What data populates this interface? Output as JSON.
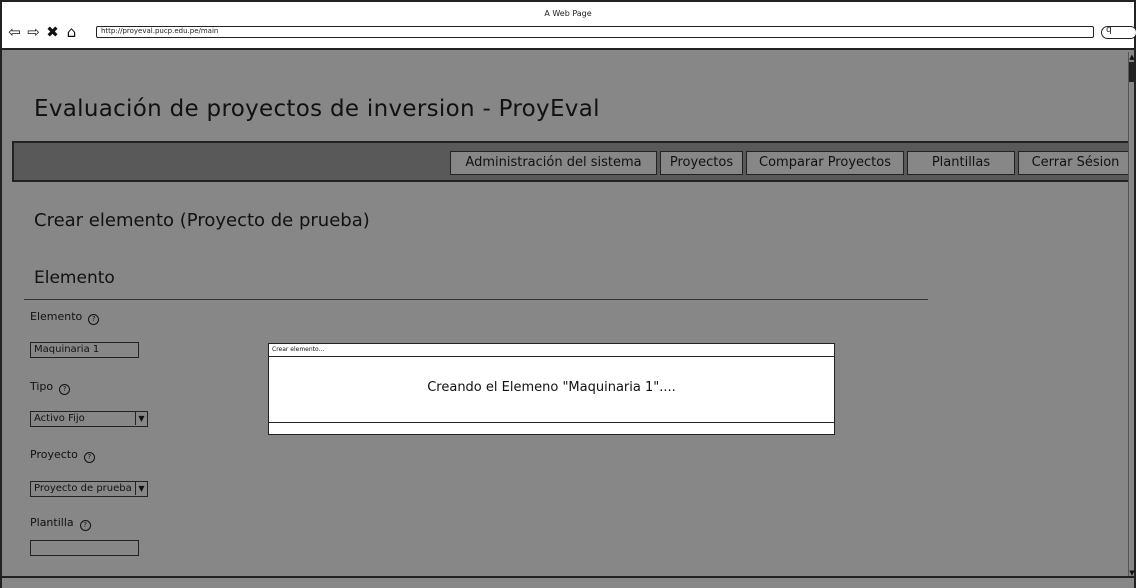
{
  "window": {
    "title": "A Web Page",
    "address": "http://proyeval.pucp.edu.pe/main",
    "nav_icons": [
      "back-arrow-icon",
      "forward-arrow-icon",
      "close-icon",
      "home-icon"
    ],
    "search_icon": "search-icon"
  },
  "app": {
    "title": "Evaluación de proyectos de inversion - ProyEval"
  },
  "menu": {
    "items": [
      {
        "label": "Administración del sistema"
      },
      {
        "label": "Proyectos"
      },
      {
        "label": "Comparar Proyectos"
      },
      {
        "label": "Plantillas"
      },
      {
        "label": "Cerrar Sésion"
      }
    ]
  },
  "main": {
    "section_title": "Crear elemento (Proyecto de prueba)",
    "sub_title": "Elemento"
  },
  "form": {
    "elemento": {
      "label": "Elemento",
      "value": "Maquinaria 1"
    },
    "tipo": {
      "label": "Tipo",
      "value": "Activo Fijo"
    },
    "proyecto": {
      "label": "Proyecto",
      "value": "Proyecto de prueba"
    },
    "plantilla": {
      "label": "Plantilla",
      "value": ""
    },
    "help_glyph": "?"
  },
  "dialog": {
    "title": "Crear elemento...",
    "message": "Creando el Elemeno \"Maquinaria 1\"...."
  },
  "colors": {
    "page_bg": "#878787",
    "menubar_bg": "#595959",
    "dialog_bg": "#ffffff",
    "border": "#222222"
  }
}
